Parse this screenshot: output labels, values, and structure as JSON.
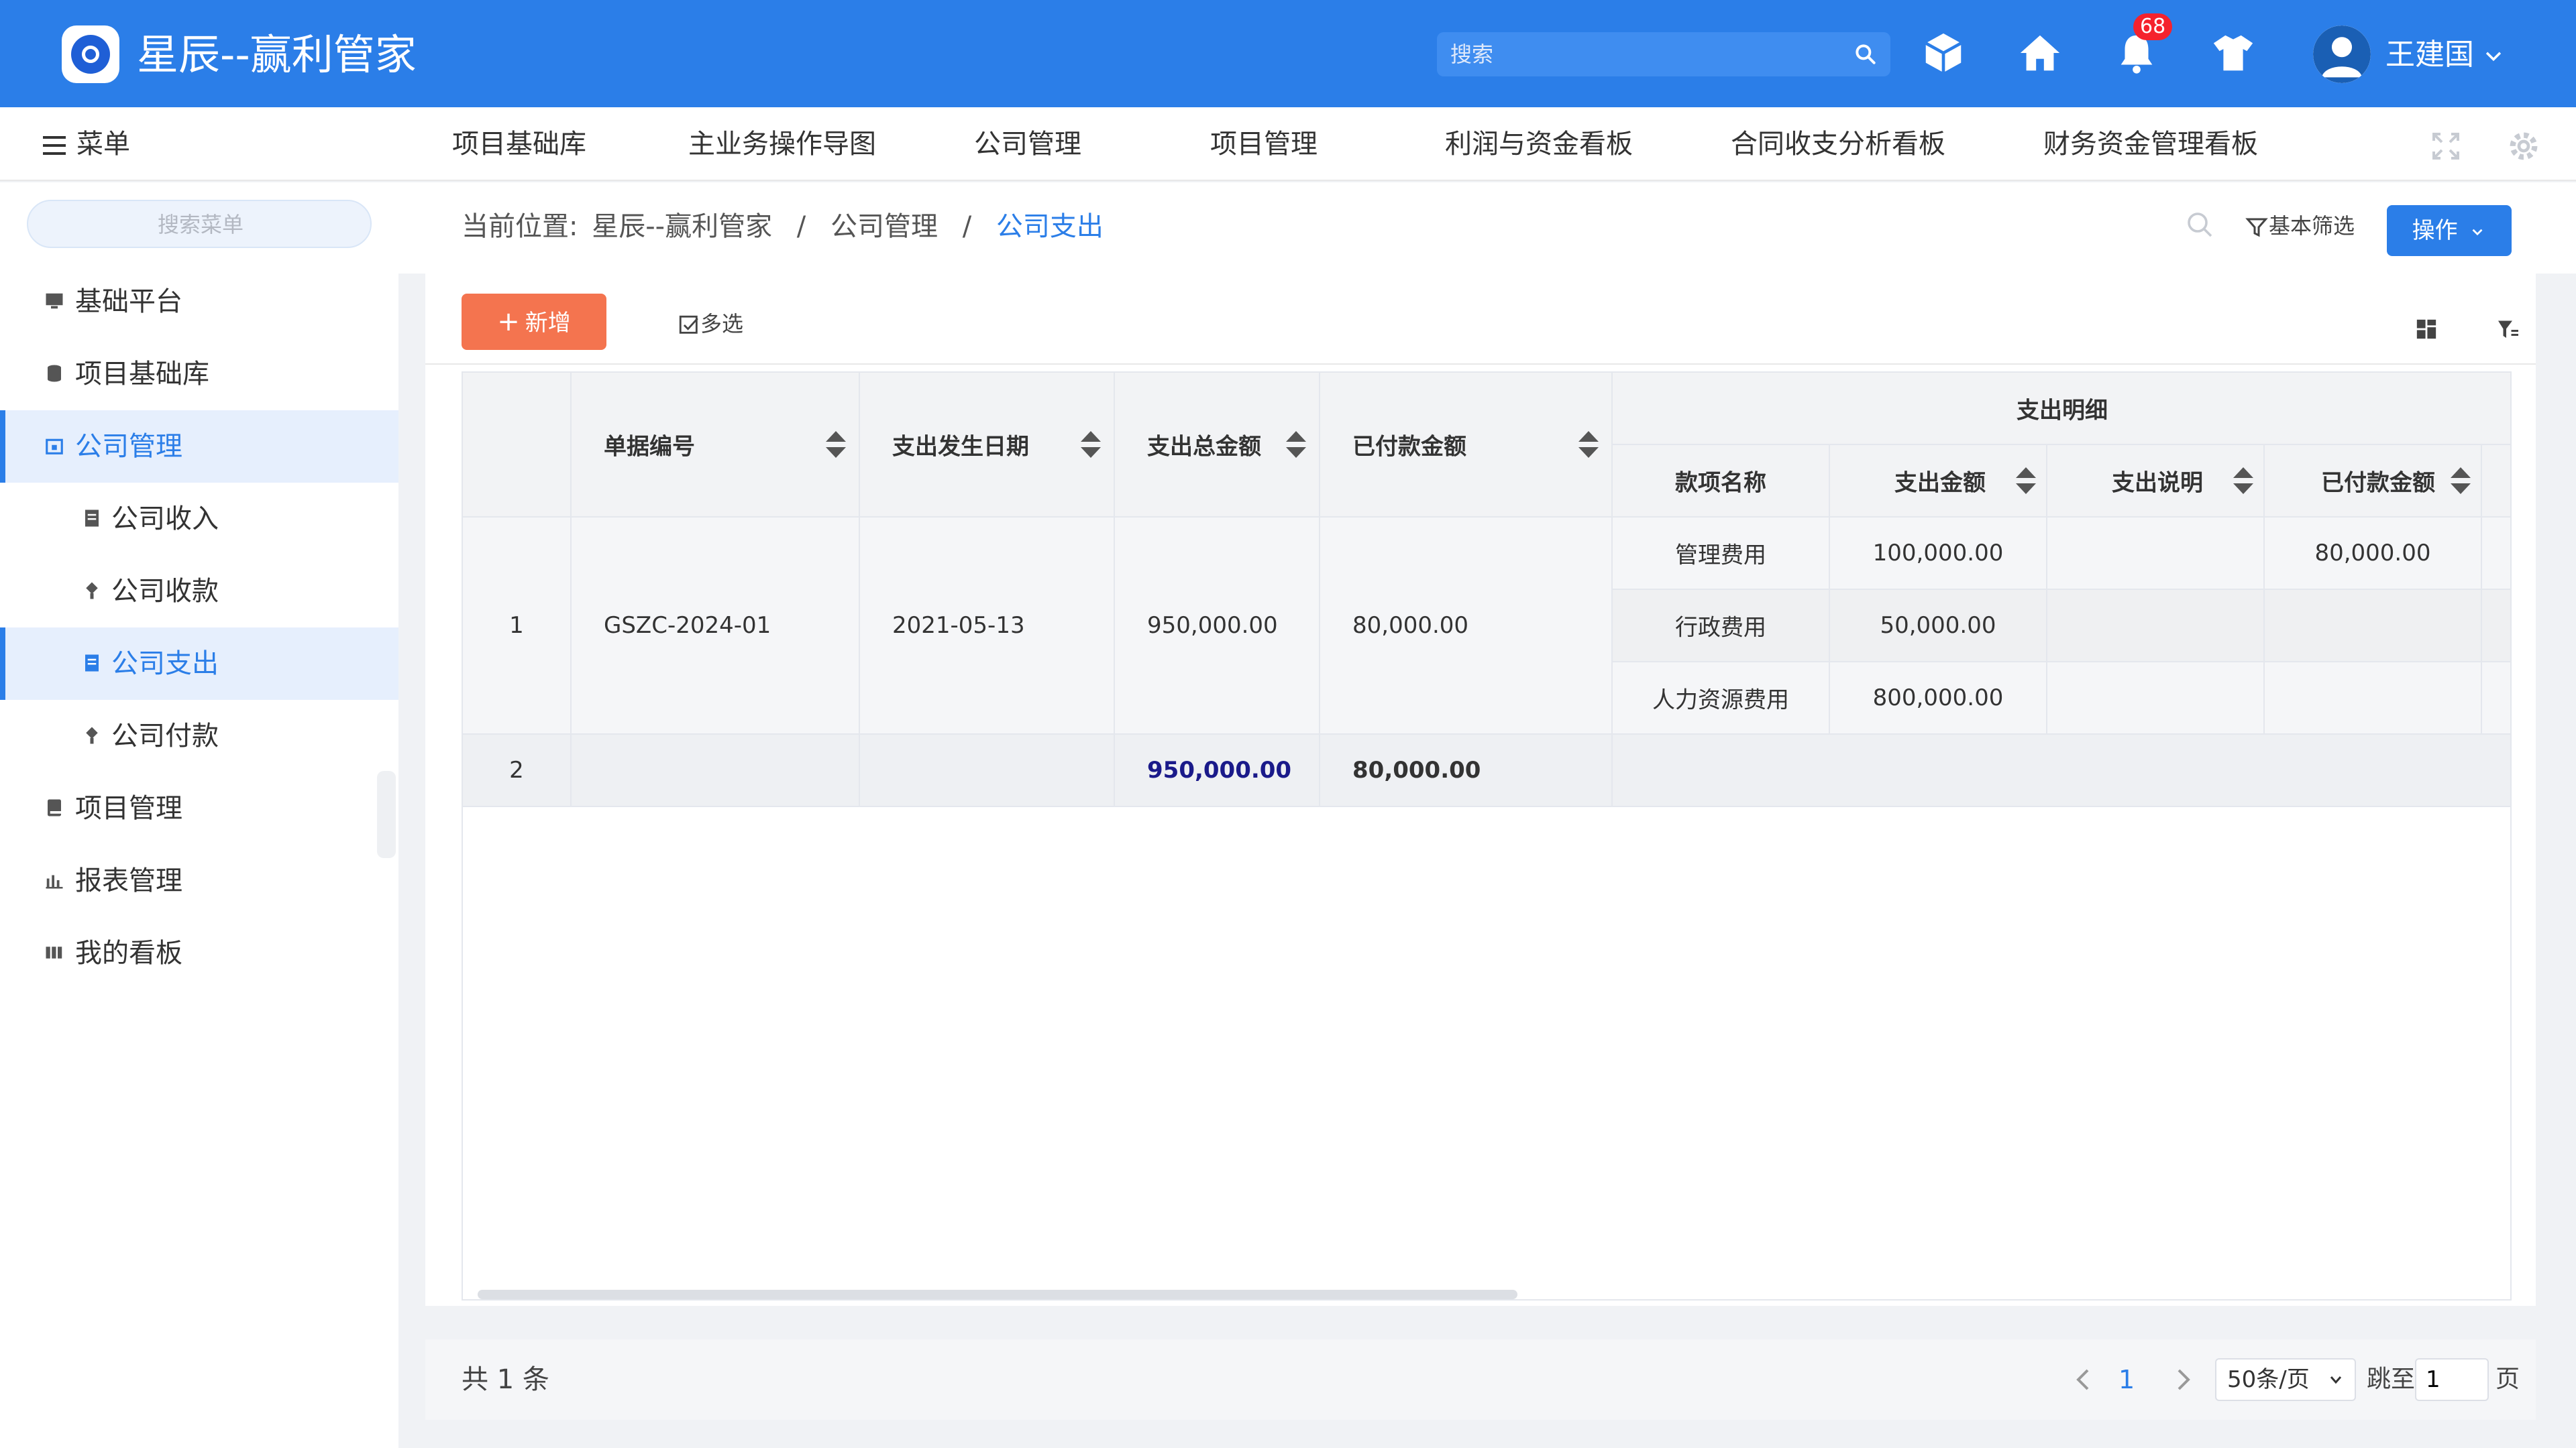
{
  "header": {
    "app_title": "星辰--赢利管家",
    "search_placeholder": "搜索",
    "notification_count": "68",
    "username": "王建国"
  },
  "navbar": {
    "menu_label": "菜单",
    "items": [
      "项目基础库",
      "主业务操作导图",
      "公司管理",
      "项目管理",
      "利润与资金看板",
      "合同收支分析看板",
      "财务资金管理看板"
    ]
  },
  "sidebar": {
    "search_placeholder": "搜索菜单",
    "items": [
      {
        "label": "基础平台",
        "icon": "monitor-icon"
      },
      {
        "label": "项目基础库",
        "icon": "database-icon"
      },
      {
        "label": "公司管理",
        "icon": "company-icon"
      },
      {
        "label": "公司收入",
        "icon": "document-icon"
      },
      {
        "label": "公司收款",
        "icon": "gem-icon"
      },
      {
        "label": "公司支出",
        "icon": "document-icon"
      },
      {
        "label": "公司付款",
        "icon": "gem-icon"
      },
      {
        "label": "项目管理",
        "icon": "book-icon"
      },
      {
        "label": "报表管理",
        "icon": "bar-chart-icon"
      },
      {
        "label": "我的看板",
        "icon": "board-icon"
      }
    ]
  },
  "breadcrumb": {
    "prefix": "当前位置:",
    "items": [
      "星辰--赢利管家",
      "公司管理",
      "公司支出"
    ],
    "separator": "/"
  },
  "actions": {
    "basic_filter": "基本筛选",
    "operate": "操作",
    "add": "新增",
    "multi_select": "多选"
  },
  "table": {
    "headers": {
      "doc_no": "单据编号",
      "date": "支出发生日期",
      "total": "支出总金额",
      "paid": "已付款金额",
      "detail_group": "支出明细",
      "item_name": "款项名称",
      "amount": "支出金额",
      "desc": "支出说明",
      "item_paid": "已付款金额"
    },
    "row": {
      "index": "1",
      "doc_no": "GSZC-2024-01",
      "date": "2021-05-13",
      "total": "950,000.00",
      "paid": "80,000.00",
      "details": [
        {
          "name": "管理费用",
          "amount": "100,000.00",
          "desc": "",
          "paid": "80,000.00"
        },
        {
          "name": "行政费用",
          "amount": "50,000.00",
          "desc": "",
          "paid": ""
        },
        {
          "name": "人力资源费用",
          "amount": "800,000.00",
          "desc": "",
          "paid": ""
        }
      ]
    },
    "summary": {
      "index": "2",
      "total": "950,000.00",
      "paid": "80,000.00"
    }
  },
  "pagination": {
    "total_text": "共 1 条",
    "current_page": "1",
    "page_size": "50条/页",
    "goto_label": "跳至",
    "goto_value": "1",
    "page_unit": "页"
  },
  "colors": {
    "primary": "#2b7ee8",
    "add_button": "#f4744f",
    "badge": "#f5222d"
  }
}
